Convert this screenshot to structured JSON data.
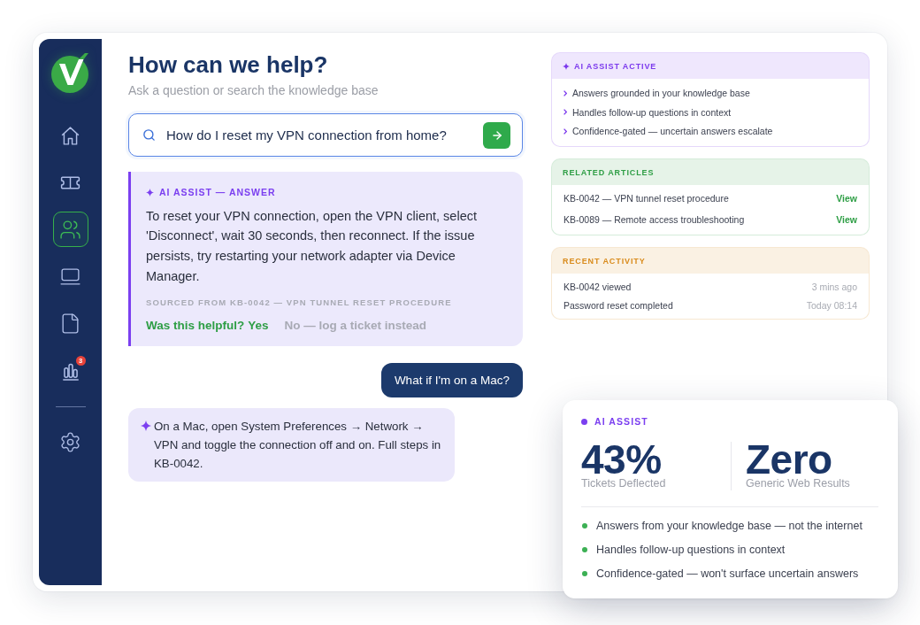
{
  "sidebar": {
    "items": [
      {
        "selected": false
      },
      {
        "selected": false
      },
      {
        "selected": true
      },
      {
        "selected": false
      },
      {
        "selected": false
      },
      {
        "selected": false,
        "badge": "3"
      }
    ],
    "bottom_items": [
      {
        "selected": false
      }
    ]
  },
  "header": {
    "title": "How can we help?",
    "subtitle": "Ask a question or search the knowledge base"
  },
  "search": {
    "value": "How do I reset my VPN connection from home?"
  },
  "answer": {
    "label": "AI ASSIST — ANSWER",
    "text": "To reset your VPN connection, open the VPN client, select 'Disconnect', wait 30 seconds, then reconnect. If the issue persists, try restarting your network adapter via Device Manager.",
    "source": "SOURCED FROM KB-0042 — VPN TUNNEL RESET PROCEDURE",
    "feedback": {
      "prompt": "Was this helpful?",
      "yes": "Yes",
      "no": "No — log a ticket instead"
    }
  },
  "chat": [
    {
      "kind": "user",
      "text": "What if I'm on a Mac?"
    },
    {
      "kind": "assistant",
      "text": "On a Mac, open System Preferences → Network → VPN and toggle the connection off and on. Full steps in KB-0042."
    }
  ],
  "panels": [
    {
      "kind": "features",
      "title": "AI ASSIST ACTIVE",
      "color": "#7c3aed",
      "items": [
        "Answers grounded in your knowledge base",
        "Handles follow-up questions in context",
        "Confidence-gated — uncertain answers escalate"
      ]
    },
    {
      "kind": "links",
      "title": "RELATED ARTICLES",
      "color": "#2e9e45",
      "rows": [
        {
          "title": "KB-0042 — VPN tunnel reset procedure",
          "action": "View"
        },
        {
          "title": "KB-0089 — Remote access troubleshooting",
          "action": "View"
        }
      ]
    },
    {
      "kind": "activity",
      "title": "RECENT ACTIVITY",
      "color": "#d98b1c",
      "rows": [
        {
          "title": "KB-0042 viewed",
          "time": "3 mins ago"
        },
        {
          "title": "Password reset completed",
          "time": "Today 08:14"
        }
      ]
    }
  ],
  "stats_card": {
    "label": "AI ASSIST",
    "stats": [
      {
        "value": "43%",
        "caption": "Tickets Deflected"
      },
      {
        "value": "Zero",
        "caption": "Generic Web Results"
      }
    ],
    "bullets": [
      "Answers from your knowledge base — not the internet",
      "Handles follow-up questions in context",
      "Confidence-gated — won't surface uncertain answers"
    ]
  }
}
